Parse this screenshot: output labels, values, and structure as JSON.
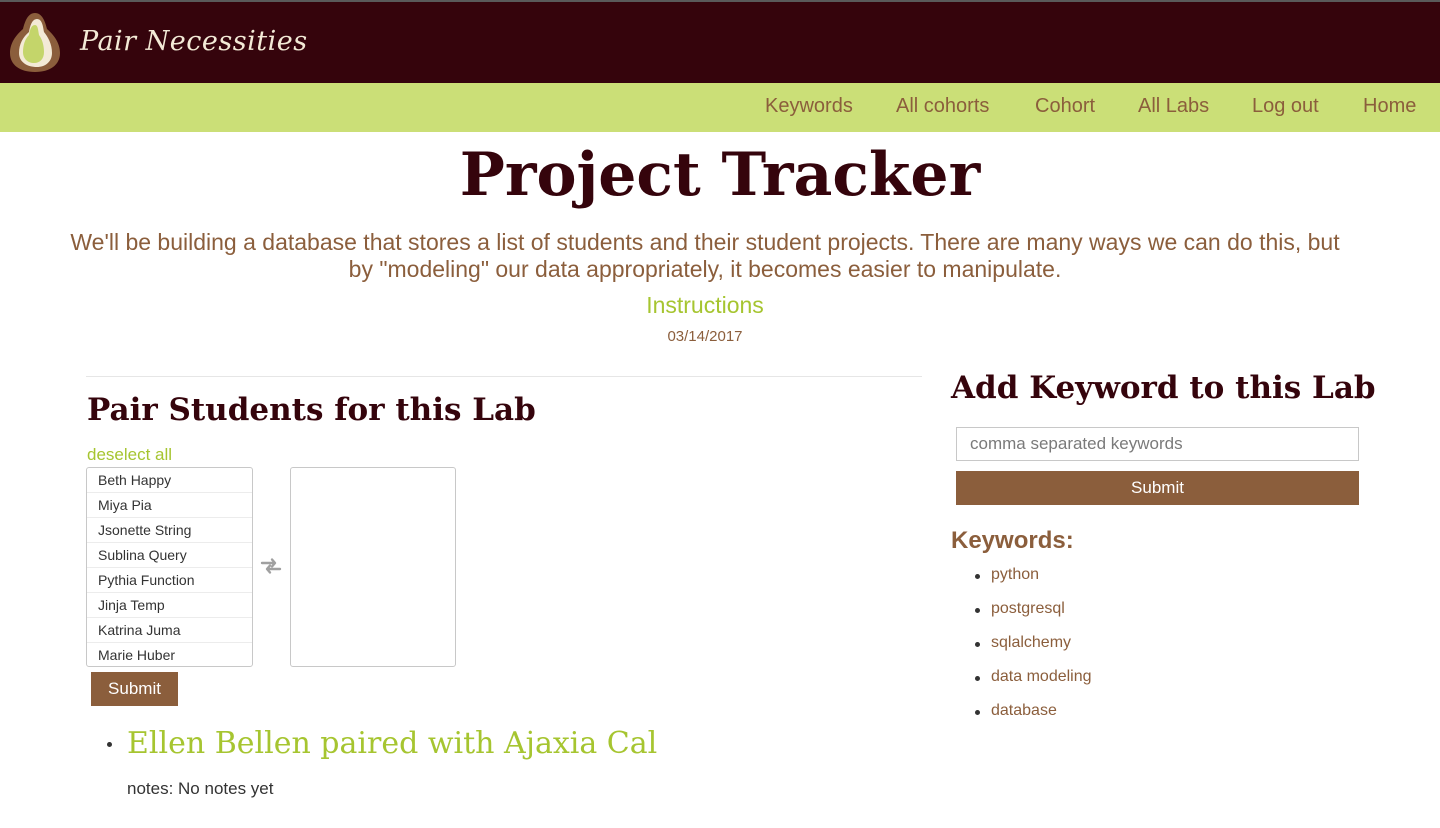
{
  "brand": {
    "name": "Pair Necessities"
  },
  "nav": {
    "items": [
      "Keywords",
      "All cohorts",
      "Cohort",
      "All Labs",
      "Log out",
      "Home"
    ]
  },
  "page": {
    "title": "Project Tracker",
    "description": "We'll be building a database that stores a list of students and their student projects. There are many ways we can do this, but by \"modeling\" our data appropriately, it becomes easier to manipulate.",
    "instructions_link": "Instructions",
    "date": "03/14/2017"
  },
  "pairing": {
    "heading": "Pair Students for this Lab",
    "deselect_label": "deselect all",
    "students": [
      "Beth Happy",
      "Miya Pia",
      "Jsonette String",
      "Sublina Query",
      "Pythia Function",
      "Jinja Temp",
      "Katrina Juma",
      "Marie Huber"
    ],
    "submit_label": "Submit",
    "swap_icon": "swap-arrows-icon",
    "pairs": [
      {
        "text": "Ellen Bellen paired with Ajaxia Cal",
        "notes": "notes: No notes yet"
      }
    ]
  },
  "keywords": {
    "heading": "Add Keyword to this Lab",
    "input_placeholder": "comma separated keywords",
    "submit_label": "Submit",
    "list_label": "Keywords:",
    "items": [
      "python",
      "postgresql",
      "sqlalchemy",
      "data modeling",
      "database"
    ]
  },
  "colors": {
    "header_bg": "#35040c",
    "nav_bg": "#cbdf77",
    "accent_brown": "#8b5e3c",
    "accent_green": "#a6c530"
  }
}
